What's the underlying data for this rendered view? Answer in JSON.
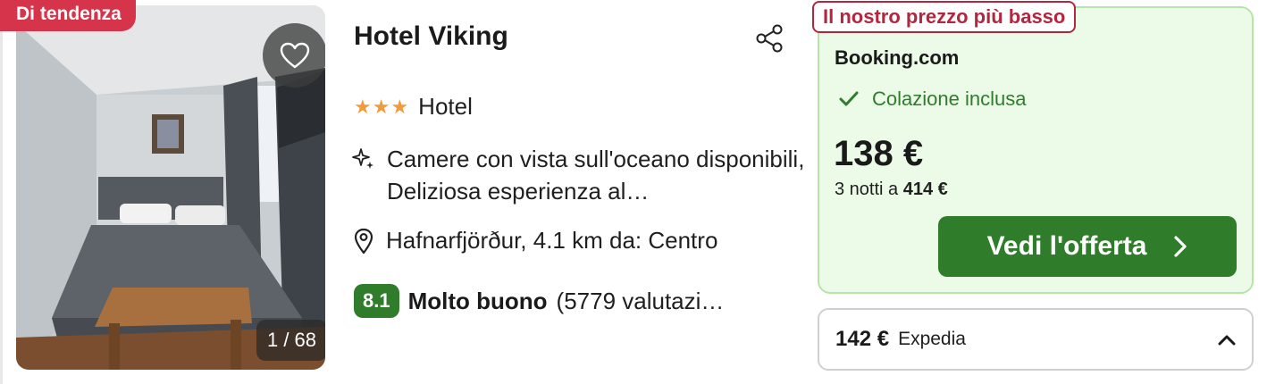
{
  "badge": {
    "trend": "Di tendenza"
  },
  "gallery": {
    "counter": "1 / 68"
  },
  "hotel": {
    "name": "Hotel Viking",
    "stars": "★★★",
    "type": "Hotel",
    "highlight": "Camere con vista sull'oceano disponibili, Deliziosa esperienza al…",
    "location": "Hafnarfjörður, 4.1 km da: Centro",
    "rating": {
      "score": "8.1",
      "word": "Molto buono",
      "count": "(5779 valutazi…"
    }
  },
  "offer": {
    "tag": "Il nostro prezzo più basso",
    "provider": "Booking.com",
    "perk": "Colazione inclusa",
    "price": "138 €",
    "nights_prefix": "3 notti a ",
    "nights_total": "414 €",
    "cta": "Vedi l'offerta"
  },
  "alt_offer": {
    "price": "142 €",
    "provider": "Expedia"
  },
  "icons": {
    "favorite": "heart-icon",
    "share": "share-icon",
    "highlight": "sparkle-icon",
    "location": "map-pin-icon",
    "perk": "check-icon",
    "cta": "chevron-right-icon",
    "expand": "chevron-up-icon"
  },
  "colors": {
    "trend_badge": "#d6344a",
    "lowest_tag": "#b3263f",
    "offer_bg": "#ecfbe8",
    "offer_border": "#b5e6a8",
    "cta": "#2f7d2a",
    "rating": "#2f7d2a",
    "stars": "#f19b3a"
  }
}
